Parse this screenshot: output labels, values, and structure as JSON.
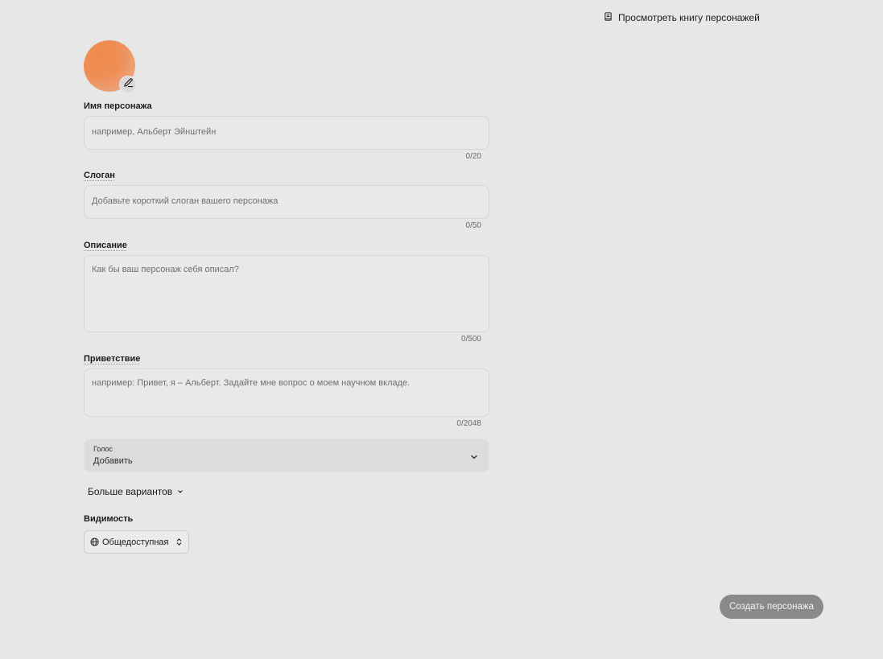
{
  "header": {
    "book_link_label": "Просмотреть книгу персонажей",
    "book_icon": "book-icon"
  },
  "avatar": {
    "gradient_colors": [
      "#f08a4a",
      "#eab39a"
    ],
    "edit_icon": "pencil-icon"
  },
  "fields": {
    "name": {
      "label": "Имя персонажа",
      "placeholder": "например, Альберт Эйнштейн",
      "value": "",
      "counter": "0/20"
    },
    "tagline": {
      "label": "Слоган",
      "placeholder": "Добавьте короткий слоган вашего персонажа",
      "value": "",
      "counter": "0/50"
    },
    "description": {
      "label": "Описание",
      "placeholder": "Как бы ваш персонаж себя описал?",
      "value": "",
      "counter": "0/500"
    },
    "greeting": {
      "label": "Приветствие",
      "placeholder": "например: Привет, я – Альберт. Задайте мне вопрос о моем научном вкладе.",
      "value": "",
      "counter": "0/2048"
    }
  },
  "voice": {
    "label": "Голос",
    "value": "Добавить",
    "chevron_icon": "chevron-down-icon"
  },
  "more_options": {
    "label": "Больше вариантов",
    "chevron_icon": "chevron-down-icon"
  },
  "visibility": {
    "label": "Видимость",
    "value": "Общедоступная",
    "globe_icon": "globe-icon",
    "updown_icon": "chevron-up-down-icon"
  },
  "actions": {
    "create_label": "Создать персонажа",
    "create_color": "#898989"
  },
  "colors": {
    "background": "#e7e7e7"
  }
}
